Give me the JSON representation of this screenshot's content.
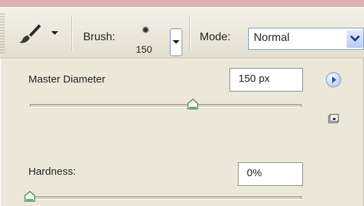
{
  "toolbar": {
    "brush_label": "Brush:",
    "brush_size": "150",
    "mode_label": "Mode:",
    "mode_value": "Normal"
  },
  "panel": {
    "master_diameter_label": "Master Diameter",
    "master_diameter_value": "150 px",
    "master_diameter_slider_fraction": 0.6,
    "hardness_label": "Hardness:",
    "hardness_value": "0%",
    "hardness_slider_fraction": 0.0
  },
  "icons": {
    "tool_preset": "brush-icon",
    "flyout": "right-arrow-circle-icon",
    "save_preset": "new-preset-icon"
  },
  "colors": {
    "panel_bg": "#ece8d9",
    "background": "#dfb1b3",
    "accent_blue": "#1f55c8"
  }
}
